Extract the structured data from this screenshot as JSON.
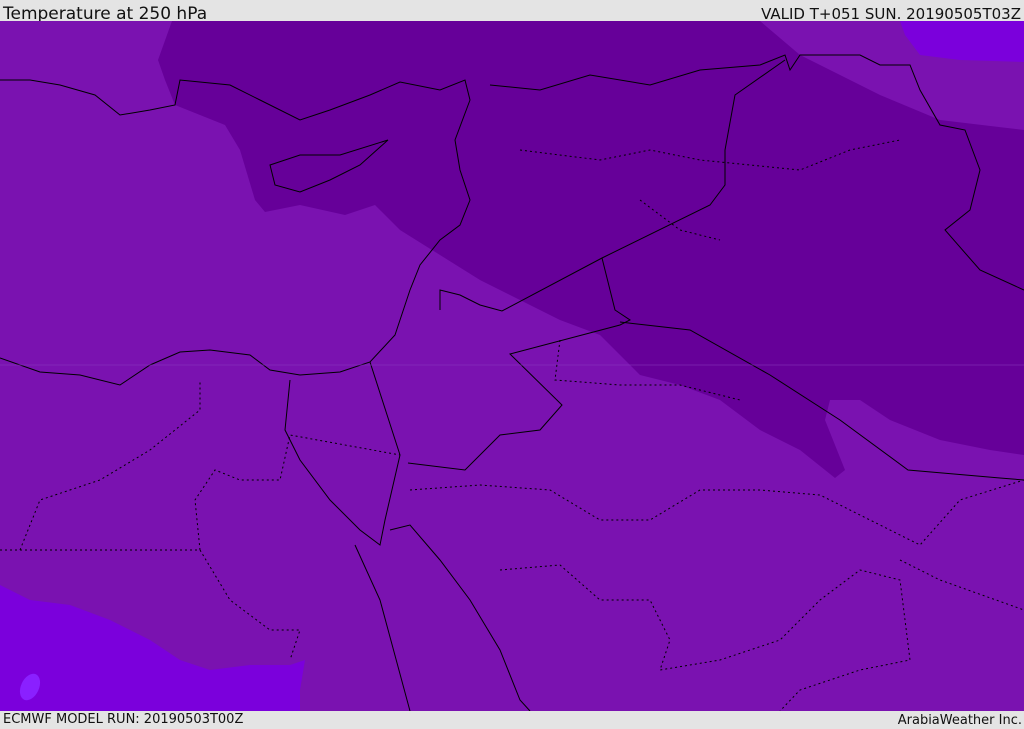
{
  "header": {
    "title": "Temperature at 250 hPa",
    "valid": "VALID T+051 SUN. 20190505T03Z"
  },
  "footer": {
    "model_run": "ECMWF MODEL RUN: 20190503T00Z",
    "brand": "ArabiaWeather Inc."
  },
  "colors": {
    "base_fill": "#7a12b0",
    "cold_fill": "#660099",
    "warm_fill": "#7b00dc",
    "border": "#000000"
  }
}
